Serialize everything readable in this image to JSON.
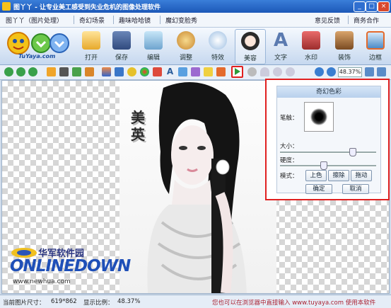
{
  "window": {
    "title": "图丫丫 - 让专业美工感受到失业危机的图像处理软件"
  },
  "menu": [
    {
      "label": "图丫丫（图片处理）"
    },
    {
      "label": "奇幻场景"
    },
    {
      "label": "趣味哈哈镜"
    },
    {
      "label": "魔幻变脸秀"
    },
    {
      "label": "意见反馈"
    },
    {
      "label": "商务合作"
    }
  ],
  "logo": {
    "text": "TuYaya.com"
  },
  "tools": [
    {
      "label": "打开",
      "icon": "folder-icon"
    },
    {
      "label": "保存",
      "icon": "floppy-icon"
    },
    {
      "label": "编辑",
      "icon": "edit-icon"
    },
    {
      "label": "调整",
      "icon": "palette-icon"
    },
    {
      "label": "特效",
      "icon": "sphere-icon"
    },
    {
      "label": "美容",
      "icon": "face-icon"
    },
    {
      "label": "文字",
      "icon": "letter-a-icon"
    },
    {
      "label": "水印",
      "icon": "watermark-icon"
    },
    {
      "label": "装饰",
      "icon": "frame-icon"
    },
    {
      "label": "边框",
      "icon": "border-icon"
    }
  ],
  "zoom": {
    "value": "48.37%"
  },
  "panel": {
    "title": "奇幻色彩",
    "brush_label": "笔触：",
    "size_label": "大小：",
    "hardness_label": "硬度：",
    "mode_label": "模式：",
    "mode_buttons": [
      "上色",
      "擦除",
      "拖动"
    ],
    "ok": "确定",
    "cancel": "取消",
    "size_value": 0.78,
    "hardness_value": 0.45
  },
  "photo": {
    "calligraphy": "美英"
  },
  "watermark": {
    "line1": "华军软件园",
    "line2": "ONLINEDOWN",
    "line3": "www.newhua.com"
  },
  "status": {
    "size_label": "当前图片尺寸：",
    "size_value": "619*862",
    "scale_label": "显示比例：",
    "scale_value": "48.37%",
    "hint": "您也可以在浏览器中直接输入 www.tuyaya.com 使用本软件"
  }
}
